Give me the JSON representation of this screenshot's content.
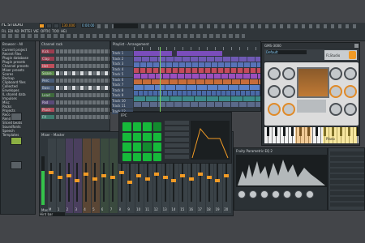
{
  "accent": {
    "orange": "#f09a25",
    "green": "#16b93a",
    "plugin_bg": "#d8d8d8",
    "daw_bg": "#2b3135"
  },
  "top": {
    "title_text": "FL STUDIO",
    "transport_time": "0:00:00",
    "tempo": "130.000",
    "menu": [
      "FILE",
      "EDIT",
      "ADD",
      "PATTERNS",
      "VIEW",
      "OPTIONS",
      "TOOLS",
      "HELP"
    ]
  },
  "browser": {
    "title": "Browser - All",
    "items": [
      "Current project",
      "Recent files",
      "Plugin database",
      "Plugin presets",
      "Channel presets",
      "Mixer presets",
      "Scores",
      "Backup",
      "Clipboard files",
      "Collected",
      "Envelopes",
      "IL shared data",
      "Impulses",
      "Misc",
      "Packs",
      "Projects",
      "Recorded",
      "Rendered",
      "Sliced beats",
      "Soundfonts",
      "Speech",
      "Templates"
    ]
  },
  "playlist": {
    "title": "Playlist - Arrangement",
    "tracks": [
      "Track 1",
      "Track 2",
      "Track 3",
      "Track 4",
      "Track 5",
      "Track 6",
      "Track 7",
      "Track 8",
      "Track 9",
      "Track 10",
      "Track 11",
      "Track 12"
    ]
  },
  "channel_rack": {
    "title": "Channel rack",
    "channels": [
      "Kick",
      "Clap",
      "Hat",
      "Snare",
      "Perc",
      "Bass",
      "Lead",
      "Pad",
      "Pluck",
      "FX"
    ]
  },
  "plugin": {
    "title": "GMS-3000",
    "preset": "Default",
    "brand": "FLStudio",
    "keyboard_label": "Piano"
  },
  "fpc": {
    "title": "FPC"
  },
  "mixer": {
    "title": "Mixer - Master",
    "master_label": "Master",
    "inserts": [
      "M",
      "1",
      "2",
      "3",
      "4",
      "5",
      "6",
      "7",
      "8",
      "9",
      "10",
      "11",
      "12",
      "13",
      "14",
      "15",
      "16",
      "17",
      "18",
      "19",
      "20"
    ]
  },
  "eq": {
    "title": "Fruity Parametric EQ 2"
  },
  "status": {
    "hint": "Hint bar"
  }
}
